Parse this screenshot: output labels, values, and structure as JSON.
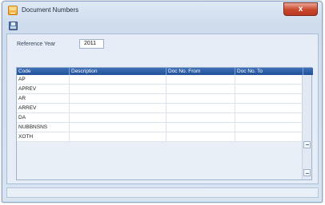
{
  "window": {
    "title": "Document Numbers",
    "close_label": "x"
  },
  "form": {
    "reference_year_label": "Reference Year",
    "reference_year_value": "2011"
  },
  "table": {
    "columns": [
      "Code",
      "Description",
      "Doc No. From",
      "Doc No. To"
    ],
    "rows": [
      [
        "AP",
        "",
        "",
        ""
      ],
      [
        "APREV",
        "",
        "",
        ""
      ],
      [
        "AR",
        "",
        "",
        ""
      ],
      [
        "ARREV",
        "",
        "",
        ""
      ],
      [
        "DA",
        "",
        "",
        ""
      ],
      [
        "NUBBNSNS",
        "",
        "",
        ""
      ],
      [
        "XOTH",
        "",
        "",
        ""
      ]
    ]
  },
  "icons": {
    "app": "document-app-icon",
    "save": "save-icon",
    "scroll_up": "chevron-up-icon",
    "scroll_down": "chevron-down-icon"
  }
}
